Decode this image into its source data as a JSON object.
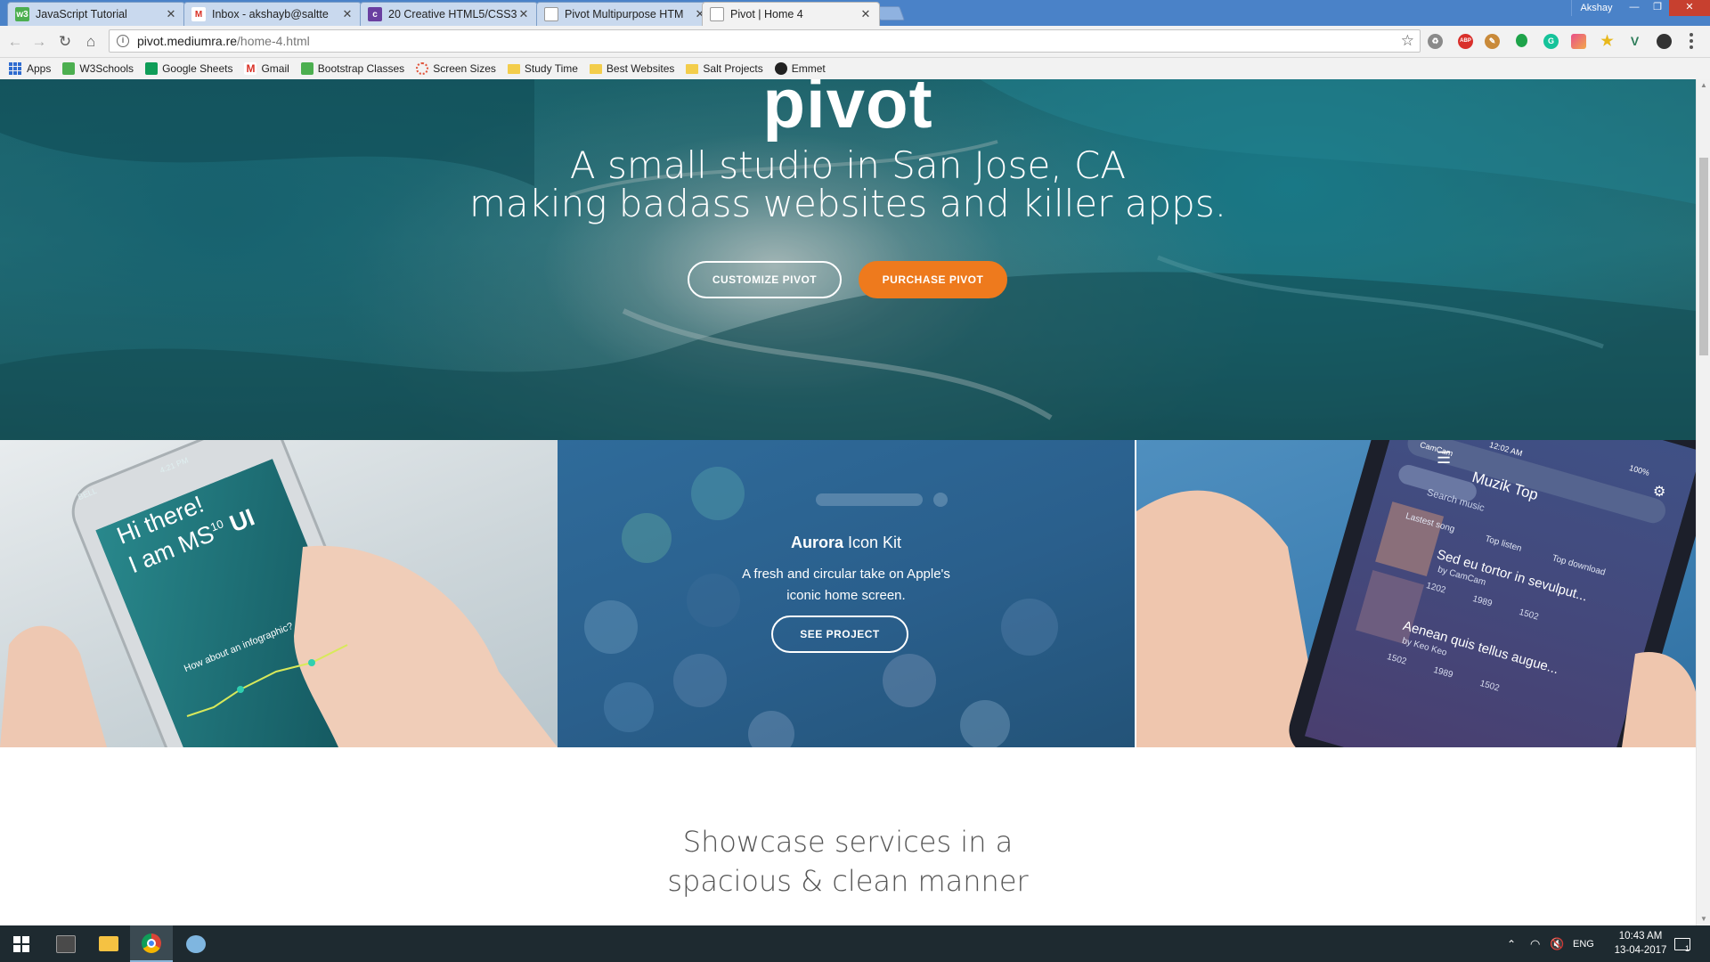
{
  "browser": {
    "tabs": [
      {
        "title": "JavaScript Tutorial",
        "icon": "w3schools-icon",
        "color": "#4caf50",
        "glyph": "w3"
      },
      {
        "title": "Inbox - akshayb@saltte",
        "icon": "gmail-icon",
        "color": "#d93025",
        "glyph": "M"
      },
      {
        "title": "20 Creative HTML5/CSS3",
        "icon": "site-icon",
        "color": "#6a3fa0",
        "glyph": "c"
      },
      {
        "title": "Pivot Multipurpose HTM",
        "icon": "page-icon",
        "color": "#ffffff",
        "glyph": ""
      },
      {
        "title": "Pivot | Home 4",
        "icon": "page-icon",
        "color": "#ffffff",
        "glyph": ""
      }
    ],
    "profile_name": "Akshay",
    "url_host": "pivot.mediumra.re",
    "url_path": "/home-4.html",
    "bookmarks": [
      {
        "label": "Apps",
        "icon": "apps-grid-icon"
      },
      {
        "label": "W3Schools",
        "icon": "w3schools-icon",
        "color": "#4caf50"
      },
      {
        "label": "Google Sheets",
        "icon": "sheets-icon",
        "color": "#0f9d58"
      },
      {
        "label": "Gmail",
        "icon": "gmail-icon",
        "color": "#d93025"
      },
      {
        "label": "Bootstrap Classes",
        "icon": "w3schools-icon",
        "color": "#4caf50"
      },
      {
        "label": "Screen Sizes",
        "icon": "gear-icon",
        "color": "#e0533a"
      },
      {
        "label": "Study Time",
        "icon": "folder-icon"
      },
      {
        "label": "Best Websites",
        "icon": "folder-icon"
      },
      {
        "label": "Salt Projects",
        "icon": "folder-icon"
      },
      {
        "label": "Emmet",
        "icon": "emmet-icon",
        "color": "#222222"
      }
    ],
    "extensions": [
      {
        "name": "recycle-icon",
        "color": "#777777",
        "glyph": "♻"
      },
      {
        "name": "adblock-icon",
        "color": "#d9302b",
        "glyph": "ABP"
      },
      {
        "name": "brush-icon",
        "color": "#c98a3a",
        "glyph": "✎"
      },
      {
        "name": "green-dot-icon",
        "color": "#1ea34a",
        "glyph": ""
      },
      {
        "name": "grammarly-icon",
        "color": "#15c39a",
        "glyph": "G"
      },
      {
        "name": "palette-icon",
        "color": "#e94f8a",
        "glyph": ""
      },
      {
        "name": "star-badge-icon",
        "color": "#e8b81c",
        "glyph": "★"
      },
      {
        "name": "vue-icon",
        "color": "#2e7d5a",
        "glyph": "V"
      },
      {
        "name": "dark-circle-icon",
        "color": "#333333",
        "glyph": ""
      }
    ]
  },
  "hero": {
    "logo": "pivot",
    "tagline_line1": "A small studio in San Jose, CA",
    "tagline_line2": "making badass websites and killer apps.",
    "customize_button": "CUSTOMIZE PIVOT",
    "purchase_button": "PURCHASE PIVOT",
    "accent_color": "#ee7a1d"
  },
  "projects": {
    "left_phone_text": [
      "Hi there!",
      "I am MS",
      "10",
      " UI",
      "How about an infographic?"
    ],
    "left_phone_status": "BELL",
    "left_phone_time": "4:21 PM",
    "center": {
      "title_bold": "Aurora",
      "title_rest": " Icon Kit",
      "desc_line1": "A fresh and circular take on Apple's",
      "desc_line2": "iconic home screen.",
      "button": "SEE PROJECT"
    },
    "right_phone": {
      "status": "CamCam",
      "time": "12:02 AM",
      "battery": "100%",
      "title": "Muzik Top",
      "search": "Search music",
      "tabs": [
        "Lastest song",
        "Top listen",
        "Top download"
      ],
      "songs": [
        {
          "title": "Sed eu tortor in sevulput...",
          "artist": "by CamCam",
          "stats": [
            "1202",
            "1989",
            "1502"
          ]
        },
        {
          "title": "Aenean quis tellus augue...",
          "artist": "by Keo Keo",
          "stats": [
            "1502",
            "1989",
            "1502"
          ]
        }
      ]
    }
  },
  "services": {
    "heading_line1": "Showcase services in a",
    "heading_line2": "spacious & clean manner"
  },
  "taskbar": {
    "lang": "ENG",
    "time": "10:43 AM",
    "date": "13-04-2017",
    "notifications": "1"
  }
}
